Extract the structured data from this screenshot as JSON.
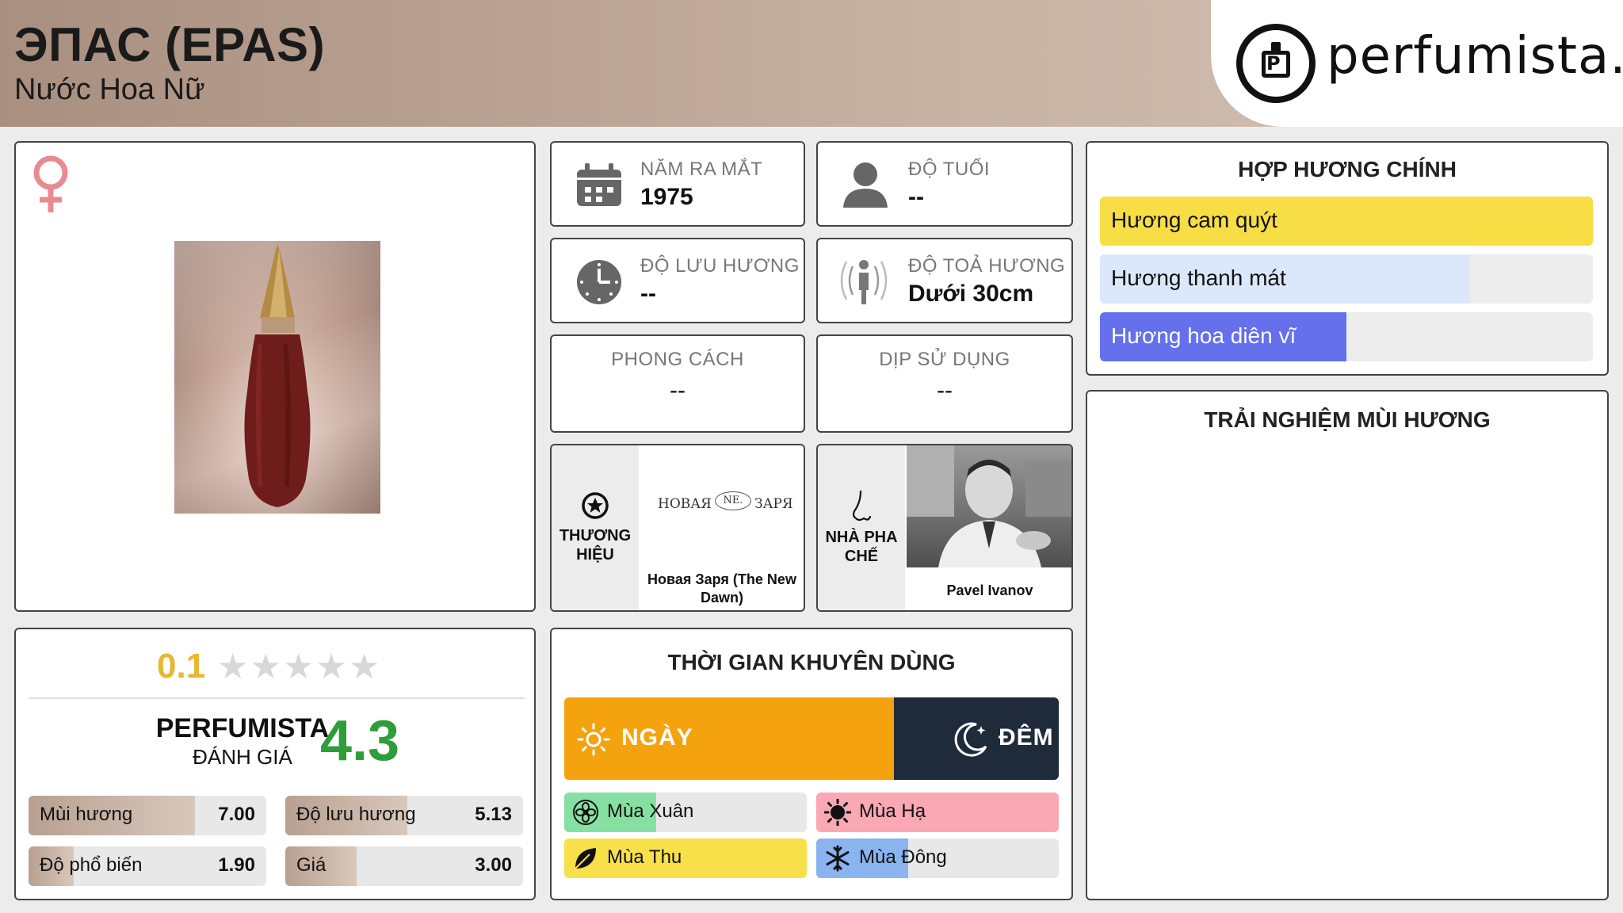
{
  "header": {
    "title": "ЭПАС (EPAS)",
    "subtitle": "Nước Hoa Nữ",
    "logo_text": "perfumista.vn"
  },
  "gender_icon": "female-symbol-icon",
  "info": {
    "year": {
      "label": "NĂM RA MẮT",
      "value": "1975",
      "icon": "calendar-icon"
    },
    "age": {
      "label": "ĐỘ TUỔI",
      "value": "--",
      "icon": "person-icon"
    },
    "longevity": {
      "label": "ĐỘ LƯU HƯƠNG",
      "value": "--",
      "icon": "clock-icon"
    },
    "sillage": {
      "label": "ĐỘ TOẢ HƯƠNG",
      "value": "Dưới 30cm",
      "icon": "sillage-person-icon"
    },
    "style": {
      "label": "PHONG CÁCH",
      "value": "--"
    },
    "occasion": {
      "label": "DỊP SỬ DỤNG",
      "value": "--"
    }
  },
  "brand": {
    "label": "THƯƠNG HIỆU",
    "logo_text_left": "НОВАЯ",
    "logo_text_mid": "NE.",
    "logo_text_right": "ЗАРЯ",
    "name": "Новая Заря (The New Dawn)",
    "icon": "star-badge-icon"
  },
  "perfumer": {
    "label": "NHÀ PHA CHẾ",
    "name": "Pavel Ivanov",
    "icon": "nose-icon"
  },
  "rating": {
    "user_score": "0.1",
    "stars_filled": 0.02,
    "stars_total": 5,
    "perfumista_label": "PERFUMISTA",
    "perfumista_sub": "ĐÁNH GIÁ",
    "perfumista_score": "4.3",
    "metrics": [
      {
        "label": "Mùi hương",
        "value": "7.00",
        "fraction": 0.7
      },
      {
        "label": "Độ lưu hương",
        "value": "5.13",
        "fraction": 0.513
      },
      {
        "label": "Độ phổ biến",
        "value": "1.90",
        "fraction": 0.19
      },
      {
        "label": "Giá",
        "value": "3.00",
        "fraction": 0.3
      }
    ]
  },
  "time": {
    "heading": "THỜI GIAN KHUYÊN DÙNG",
    "day_label": "NGÀY",
    "night_label": "ĐÊM",
    "day_fraction": 0.667,
    "seasons": [
      {
        "label": "Mùa Xuân",
        "fraction": 0.38,
        "color": "#86e0a2",
        "icon": "flower-icon"
      },
      {
        "label": "Mùa Hạ",
        "fraction": 1.0,
        "color": "#f9a8b4",
        "icon": "sun-icon"
      },
      {
        "label": "Mùa Thu",
        "fraction": 1.0,
        "color": "#f8e04a",
        "icon": "leaf-icon"
      },
      {
        "label": "Mùa Đông",
        "fraction": 0.38,
        "color": "#8ab4f0",
        "icon": "snowflake-icon"
      }
    ]
  },
  "accords": {
    "heading": "HỢP HƯƠNG CHÍNH",
    "items": [
      {
        "label": "Hương cam quýt",
        "fraction": 1.0,
        "color": "#f8de45",
        "text_color": "#111111"
      },
      {
        "label": "Hương thanh mát",
        "fraction": 0.75,
        "color": "#dbe8fb",
        "text_color": "#111111"
      },
      {
        "label": "Hương hoa diên vĩ",
        "fraction": 0.5,
        "color": "#6470ec",
        "text_color": "#ffffff"
      }
    ]
  },
  "experience": {
    "heading": "TRẢI NGHIỆM MÙI HƯƠNG"
  }
}
